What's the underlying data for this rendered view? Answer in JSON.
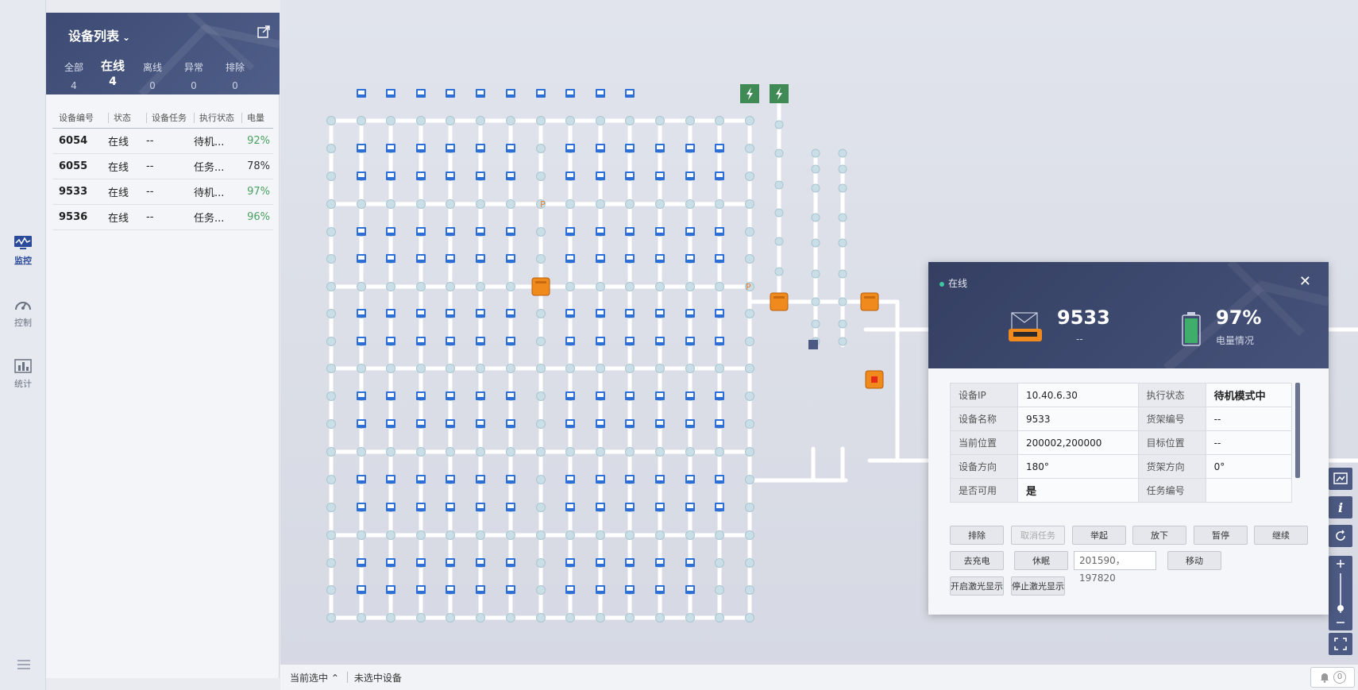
{
  "nav": {
    "items": [
      {
        "label": "监控",
        "icon": "monitor-icon",
        "active": true
      },
      {
        "label": "控制",
        "icon": "gauge-icon",
        "active": false
      },
      {
        "label": "统计",
        "icon": "bar-chart-icon",
        "active": false
      }
    ],
    "menu_icon": "menu-icon"
  },
  "device_list": {
    "title": "设备列表",
    "tabs": [
      {
        "label": "全部",
        "count": "4"
      },
      {
        "label": "在线",
        "count": "4",
        "active": true
      },
      {
        "label": "离线",
        "count": "0"
      },
      {
        "label": "异常",
        "count": "0"
      },
      {
        "label": "排除",
        "count": "0"
      }
    ],
    "columns": [
      "设备编号",
      "状态",
      "设备任务",
      "执行状态",
      "电量"
    ],
    "rows": [
      {
        "id": "6054",
        "status": "在线",
        "task": "--",
        "exec": "待机...",
        "power": "92%"
      },
      {
        "id": "6055",
        "status": "在线",
        "task": "--",
        "exec": "任务...",
        "power": "78%"
      },
      {
        "id": "9533",
        "status": "在线",
        "task": "--",
        "exec": "待机...",
        "power": "97%"
      },
      {
        "id": "9536",
        "status": "在线",
        "task": "--",
        "exec": "任务...",
        "power": "96%"
      }
    ]
  },
  "map": {
    "markers": [
      "P",
      "P"
    ],
    "charge_icon": "lightning-icon"
  },
  "popup": {
    "status": "在线",
    "device_no": "9533",
    "task": "--",
    "battery_pct": "97%",
    "battery_label": "电量情况",
    "info": [
      {
        "k1": "设备IP",
        "v1": "10.40.6.30",
        "k2": "执行状态",
        "v2": "待机模式中"
      },
      {
        "k1": "设备名称",
        "v1": "9533",
        "k2": "货架编号",
        "v2": "--"
      },
      {
        "k1": "当前位置",
        "v1": "200002,200000",
        "k2": "目标位置",
        "v2": "--"
      },
      {
        "k1": "设备方向",
        "v1": "180°",
        "k2": "货架方向",
        "v2": "0°"
      },
      {
        "k1": "是否可用",
        "v1": "是",
        "k2": "任务编号",
        "v2": ""
      }
    ],
    "buttons": {
      "exclude": "排除",
      "cancel_task": "取消任务",
      "lift": "举起",
      "drop": "放下",
      "pause": "暂停",
      "resume": "继续",
      "charge": "去充电",
      "sleep": "休眠",
      "move": "移动",
      "laser_on": "开启激光显示",
      "laser_off": "停止激光显示"
    },
    "coord_value": "201590，197820"
  },
  "status_bar": {
    "current_label": "当前选中",
    "selection": "未选中设备",
    "alarm_count": "0"
  },
  "colors": {
    "header_dark": "#3d4b74",
    "online_green": "#4aa060",
    "robot_orange": "#f08a1c",
    "shelf_blue": "#2d6fd6",
    "charger_green": "#3f8a55"
  }
}
